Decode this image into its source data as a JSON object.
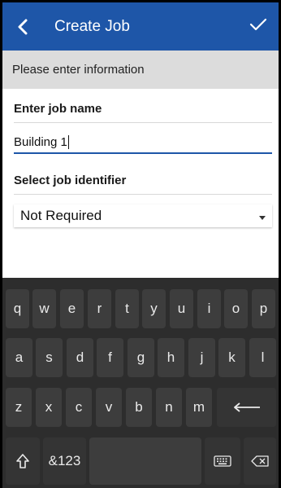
{
  "appbar": {
    "title": "Create Job",
    "back_icon": "chevron-left-icon",
    "confirm_icon": "checkmark-icon",
    "color": "#1e56a8"
  },
  "banner": {
    "text": "Please enter information"
  },
  "form": {
    "job_name_label": "Enter job name",
    "job_name_value": "Building 1",
    "identifier_label": "Select job identifier",
    "identifier_value": "Not Required",
    "dropdown_icon": "caret-down-icon"
  },
  "keyboard": {
    "row1": [
      "q",
      "w",
      "e",
      "r",
      "t",
      "y",
      "u",
      "i",
      "o",
      "p"
    ],
    "row2": [
      "a",
      "s",
      "d",
      "f",
      "g",
      "h",
      "j",
      "k",
      "l"
    ],
    "row3": [
      "z",
      "x",
      "c",
      "v",
      "b",
      "n",
      "m"
    ],
    "symbols_label": "&123",
    "shift_icon": "shift-icon",
    "enter_icon": "enter-icon",
    "keyboard_icon": "keyboard-icon",
    "backspace_icon": "backspace-icon"
  }
}
